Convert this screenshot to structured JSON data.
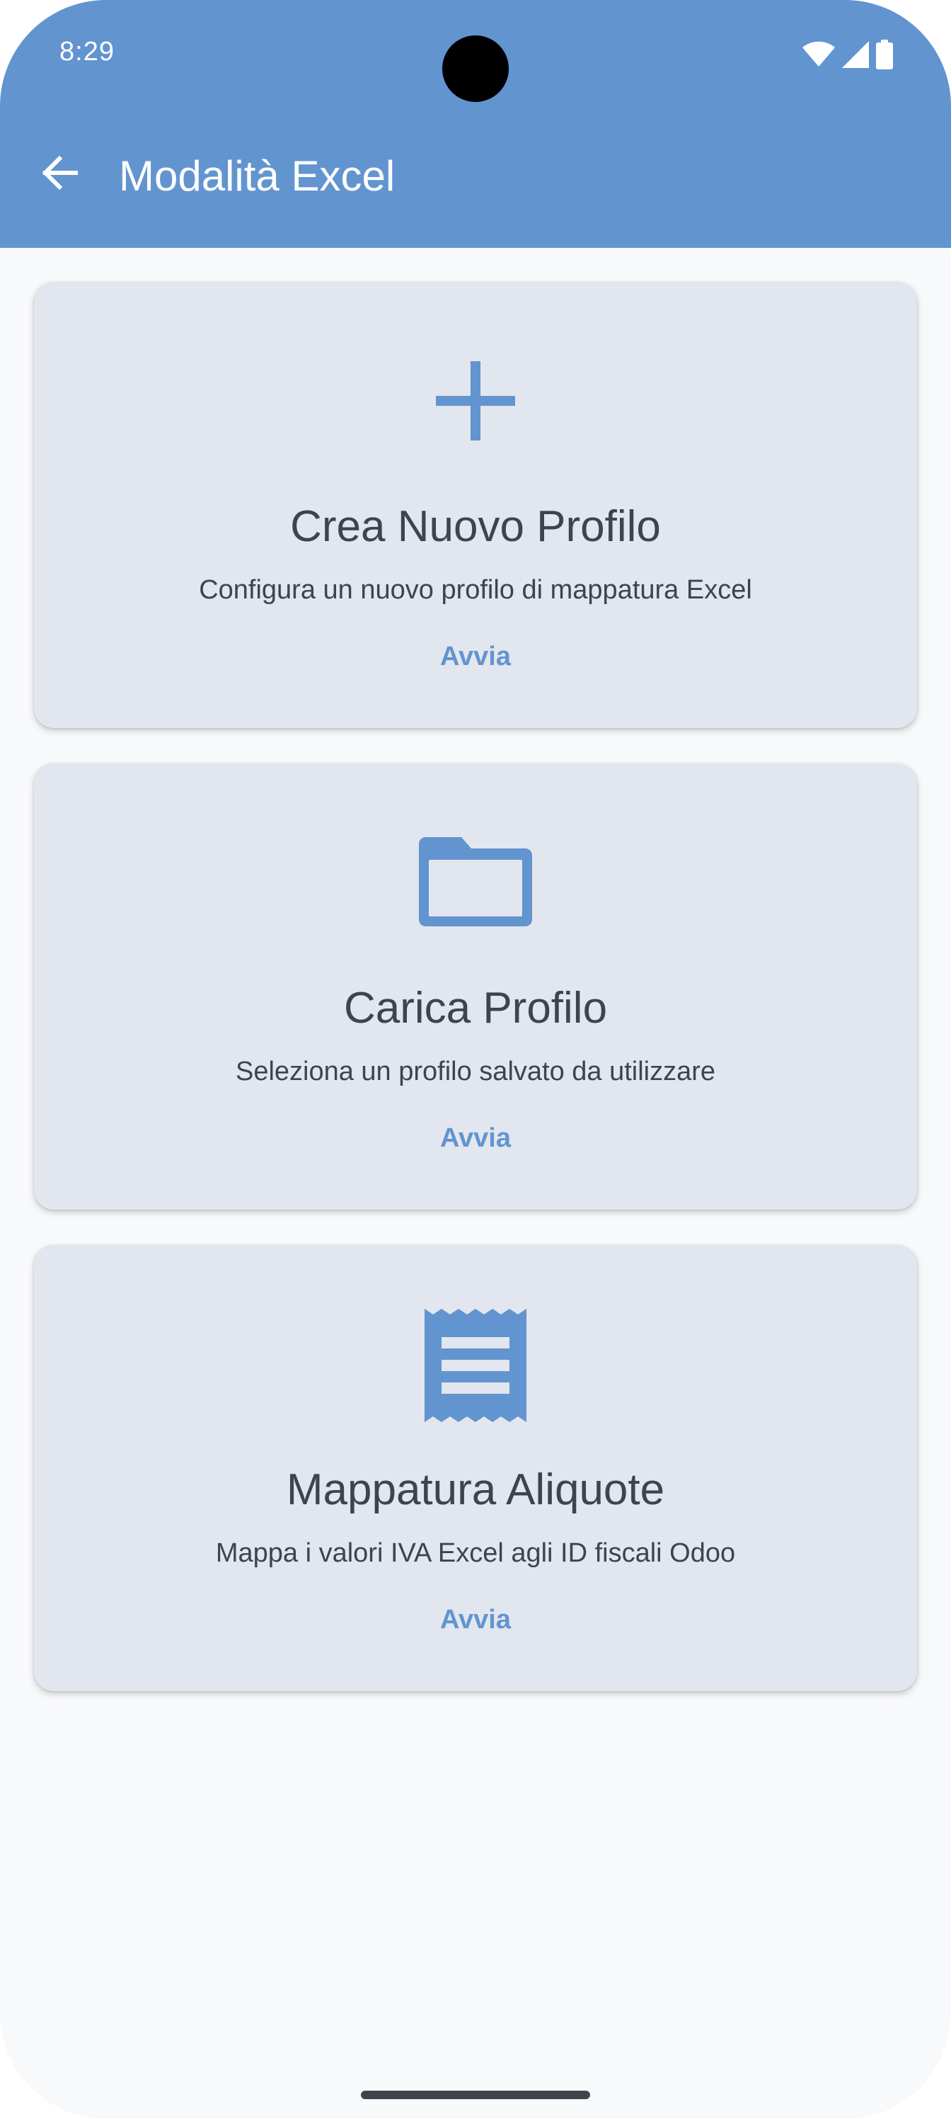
{
  "status_bar": {
    "time": "8:29",
    "icons": [
      "wifi-icon",
      "cell-signal-icon",
      "battery-icon"
    ]
  },
  "app_bar": {
    "back_icon": "arrow-left-icon",
    "title": "Modalità Excel"
  },
  "cards": [
    {
      "icon": "plus-icon",
      "title": "Crea Nuovo Profilo",
      "subtitle": "Configura un nuovo profilo di mappatura Excel",
      "action": "Avvia"
    },
    {
      "icon": "folder-icon",
      "title": "Carica Profilo",
      "subtitle": "Seleziona un profilo salvato da utilizzare",
      "action": "Avvia"
    },
    {
      "icon": "receipt-icon",
      "title": "Mappatura Aliquote",
      "subtitle": "Mappa i valori IVA Excel agli ID fiscali Odoo",
      "action": "Avvia"
    }
  ],
  "colors": {
    "primary": "#6294d0",
    "card_background": "#e2e6ee",
    "text": "#3f444c",
    "page_background": "#f8f9fb"
  }
}
